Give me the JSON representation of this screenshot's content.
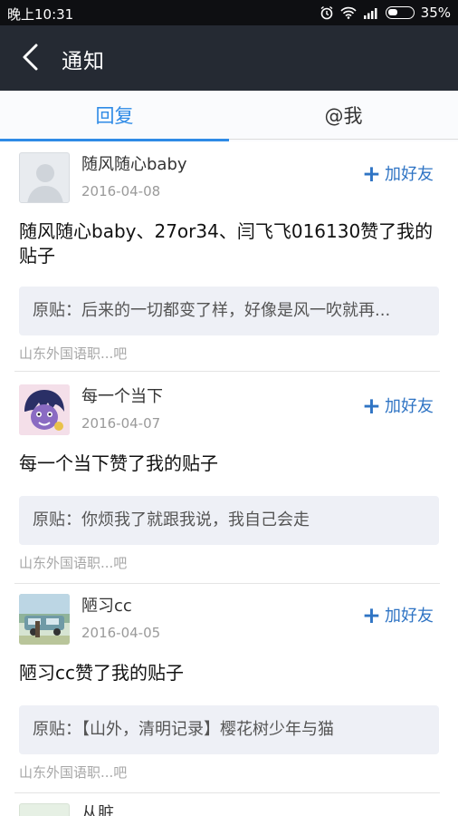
{
  "status_bar": {
    "time": "晚上10:31",
    "battery": "35%"
  },
  "header": {
    "title": "通知"
  },
  "tabs": [
    {
      "label": "回复"
    },
    {
      "label": "@我"
    }
  ],
  "notifications": [
    {
      "username": "随风随心baby",
      "date": "2016-04-08",
      "add_friend_label": "加好友",
      "action_text": "随风随心baby、27or34、闫飞飞016130赞了我的贴子",
      "original_post": "原贴：后来的一切都变了样，好像是风一吹就再...",
      "forum": "山东外国语职...吧"
    },
    {
      "username": "每一个当下",
      "date": "2016-04-07",
      "add_friend_label": "加好友",
      "action_text": "每一个当下赞了我的贴子",
      "original_post": "原贴：你烦我了就跟我说，我自己会走",
      "forum": "山东外国语职...吧"
    },
    {
      "username": "陋习cc",
      "date": "2016-04-05",
      "add_friend_label": "加好友",
      "action_text": "陋习cc赞了我的贴子",
      "original_post": "原贴：【山外，清明记录】樱花树少年与猫",
      "forum": "山东外国语职...吧"
    },
    {
      "username": "从脏"
    }
  ],
  "colors": {
    "accent": "#2f8be6",
    "header_bg": "#252a33",
    "add_friend": "#2f74c4"
  }
}
